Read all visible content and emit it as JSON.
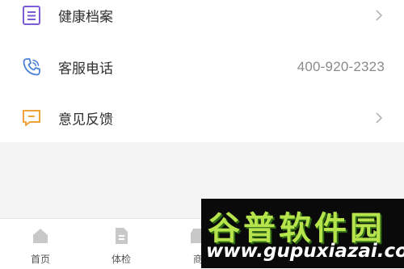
{
  "menu": {
    "items": [
      {
        "label": "健康档案",
        "icon": "health-record-icon",
        "icon_color": "#7b5cd6",
        "value": null,
        "has_chevron": true
      },
      {
        "label": "客服电话",
        "icon": "phone-icon",
        "icon_color": "#4a7fd8",
        "value": "400-920-2323",
        "has_chevron": false
      },
      {
        "label": "意见反馈",
        "icon": "feedback-icon",
        "icon_color": "#f0a23a",
        "value": null,
        "has_chevron": true
      }
    ]
  },
  "tabbar": {
    "items": [
      {
        "label": "首页",
        "icon": "home-icon"
      },
      {
        "label": "体检",
        "icon": "checkup-icon"
      },
      {
        "label": "商",
        "icon": "shop-icon"
      }
    ]
  },
  "watermark": {
    "title": "谷普软件园",
    "url": "www.gupuxiazai.com"
  },
  "colors": {
    "background": "#f4f4f4",
    "text": "#2f2f2f",
    "muted": "#8a8a8a",
    "tab_icon": "#c8c8c8"
  }
}
